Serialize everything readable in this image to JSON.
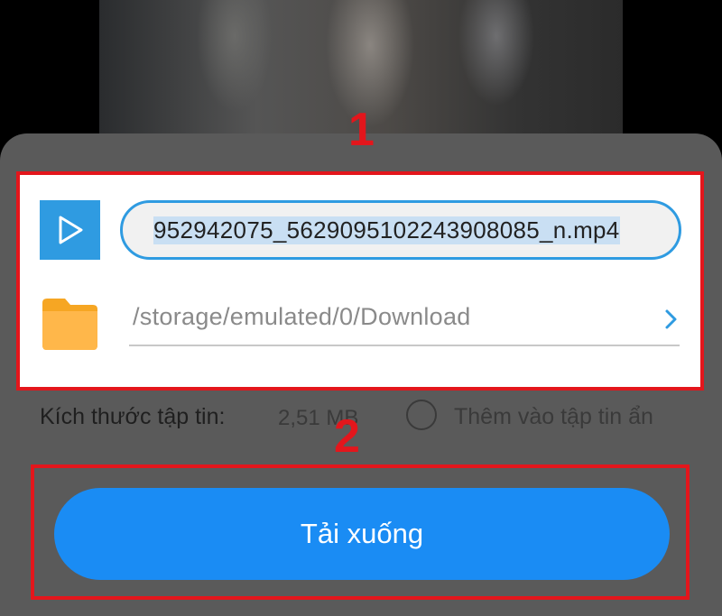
{
  "annotations": {
    "marker_1": "1",
    "marker_2": "2",
    "box_color": "#e3161c"
  },
  "file": {
    "icon": "play-icon",
    "name": "952942075_562909510224390808 5_n.mp4",
    "name_display": "952942075_5629095102243908085_n.mp4"
  },
  "location": {
    "icon": "folder-icon",
    "path": "/storage/emulated/0/Download",
    "chevron_icon": "chevron-right-icon"
  },
  "file_size": {
    "label": "Kích thước tập tin:",
    "value": "2,51 MB"
  },
  "hidden_option": {
    "label": "Thêm vào tập tin ẩn",
    "checked": false
  },
  "download_button": {
    "label": "Tải xuống",
    "color": "#1a8cf4"
  },
  "colors": {
    "accent": "#2f9be1",
    "overlay": "#5a5a5a"
  }
}
